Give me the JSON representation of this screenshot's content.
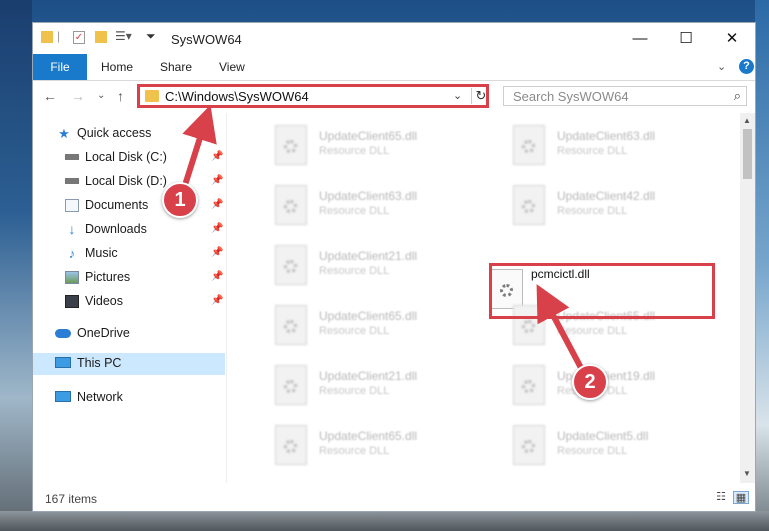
{
  "window": {
    "title": "SysWOW64",
    "minimize_glyph": "—",
    "maximize_glyph": "☐",
    "close_glyph": "✕"
  },
  "ribbon": {
    "file_label": "File",
    "tabs": [
      "Home",
      "Share",
      "View"
    ],
    "help_glyph": "?",
    "expand_glyph": "⌄"
  },
  "navigation": {
    "address_path": "C:\\Windows\\SysWOW64",
    "search_placeholder": "Search SysWOW64"
  },
  "sidebar": {
    "items": [
      {
        "label": "Quick access",
        "icon": "star-icon"
      },
      {
        "label": "Local Disk (C:)",
        "icon": "drive-icon"
      },
      {
        "label": "Local Disk (D:)",
        "icon": "drive-icon"
      },
      {
        "label": "Documents",
        "icon": "documents-icon"
      },
      {
        "label": "Downloads",
        "icon": "download-icon"
      },
      {
        "label": "Music",
        "icon": "music-icon"
      },
      {
        "label": "Pictures",
        "icon": "pictures-icon"
      },
      {
        "label": "Videos",
        "icon": "videos-icon"
      },
      {
        "label": "OneDrive",
        "icon": "cloud-icon"
      },
      {
        "label": "This PC",
        "icon": "computer-icon"
      },
      {
        "label": "Network",
        "icon": "network-icon"
      }
    ]
  },
  "files": [
    {
      "name": "UpdateClient65.dll",
      "type": "Resource DLL"
    },
    {
      "name": "UpdateClient63.dll",
      "type": "Resource DLL"
    },
    {
      "name": "UpdateClient63.dll",
      "type": "Resource DLL"
    },
    {
      "name": "UpdateClient42.dll",
      "type": "Resource DLL"
    },
    {
      "name": "UpdateClient21.dll",
      "type": "Resource DLL"
    },
    {
      "name": "pcmcictl.dll",
      "type": ""
    },
    {
      "name": "UpdateClient65.dll",
      "type": "Resource DLL"
    },
    {
      "name": "UpdateClient65.dll",
      "type": "Resource DLL"
    },
    {
      "name": "UpdateClient21.dll",
      "type": "Resource DLL"
    },
    {
      "name": "UpdateClient19.dll",
      "type": "Resource DLL"
    },
    {
      "name": "UpdateClient65.dll",
      "type": "Resource DLL"
    },
    {
      "name": "UpdateClient5.dll",
      "type": "Resource DLL"
    }
  ],
  "status": {
    "item_count": "167 items"
  },
  "annotations": {
    "step1": "1",
    "step2": "2"
  },
  "colors": {
    "accent": "#1979ca",
    "highlight": "#d8404a",
    "selected_bg": "#cce8ff"
  }
}
